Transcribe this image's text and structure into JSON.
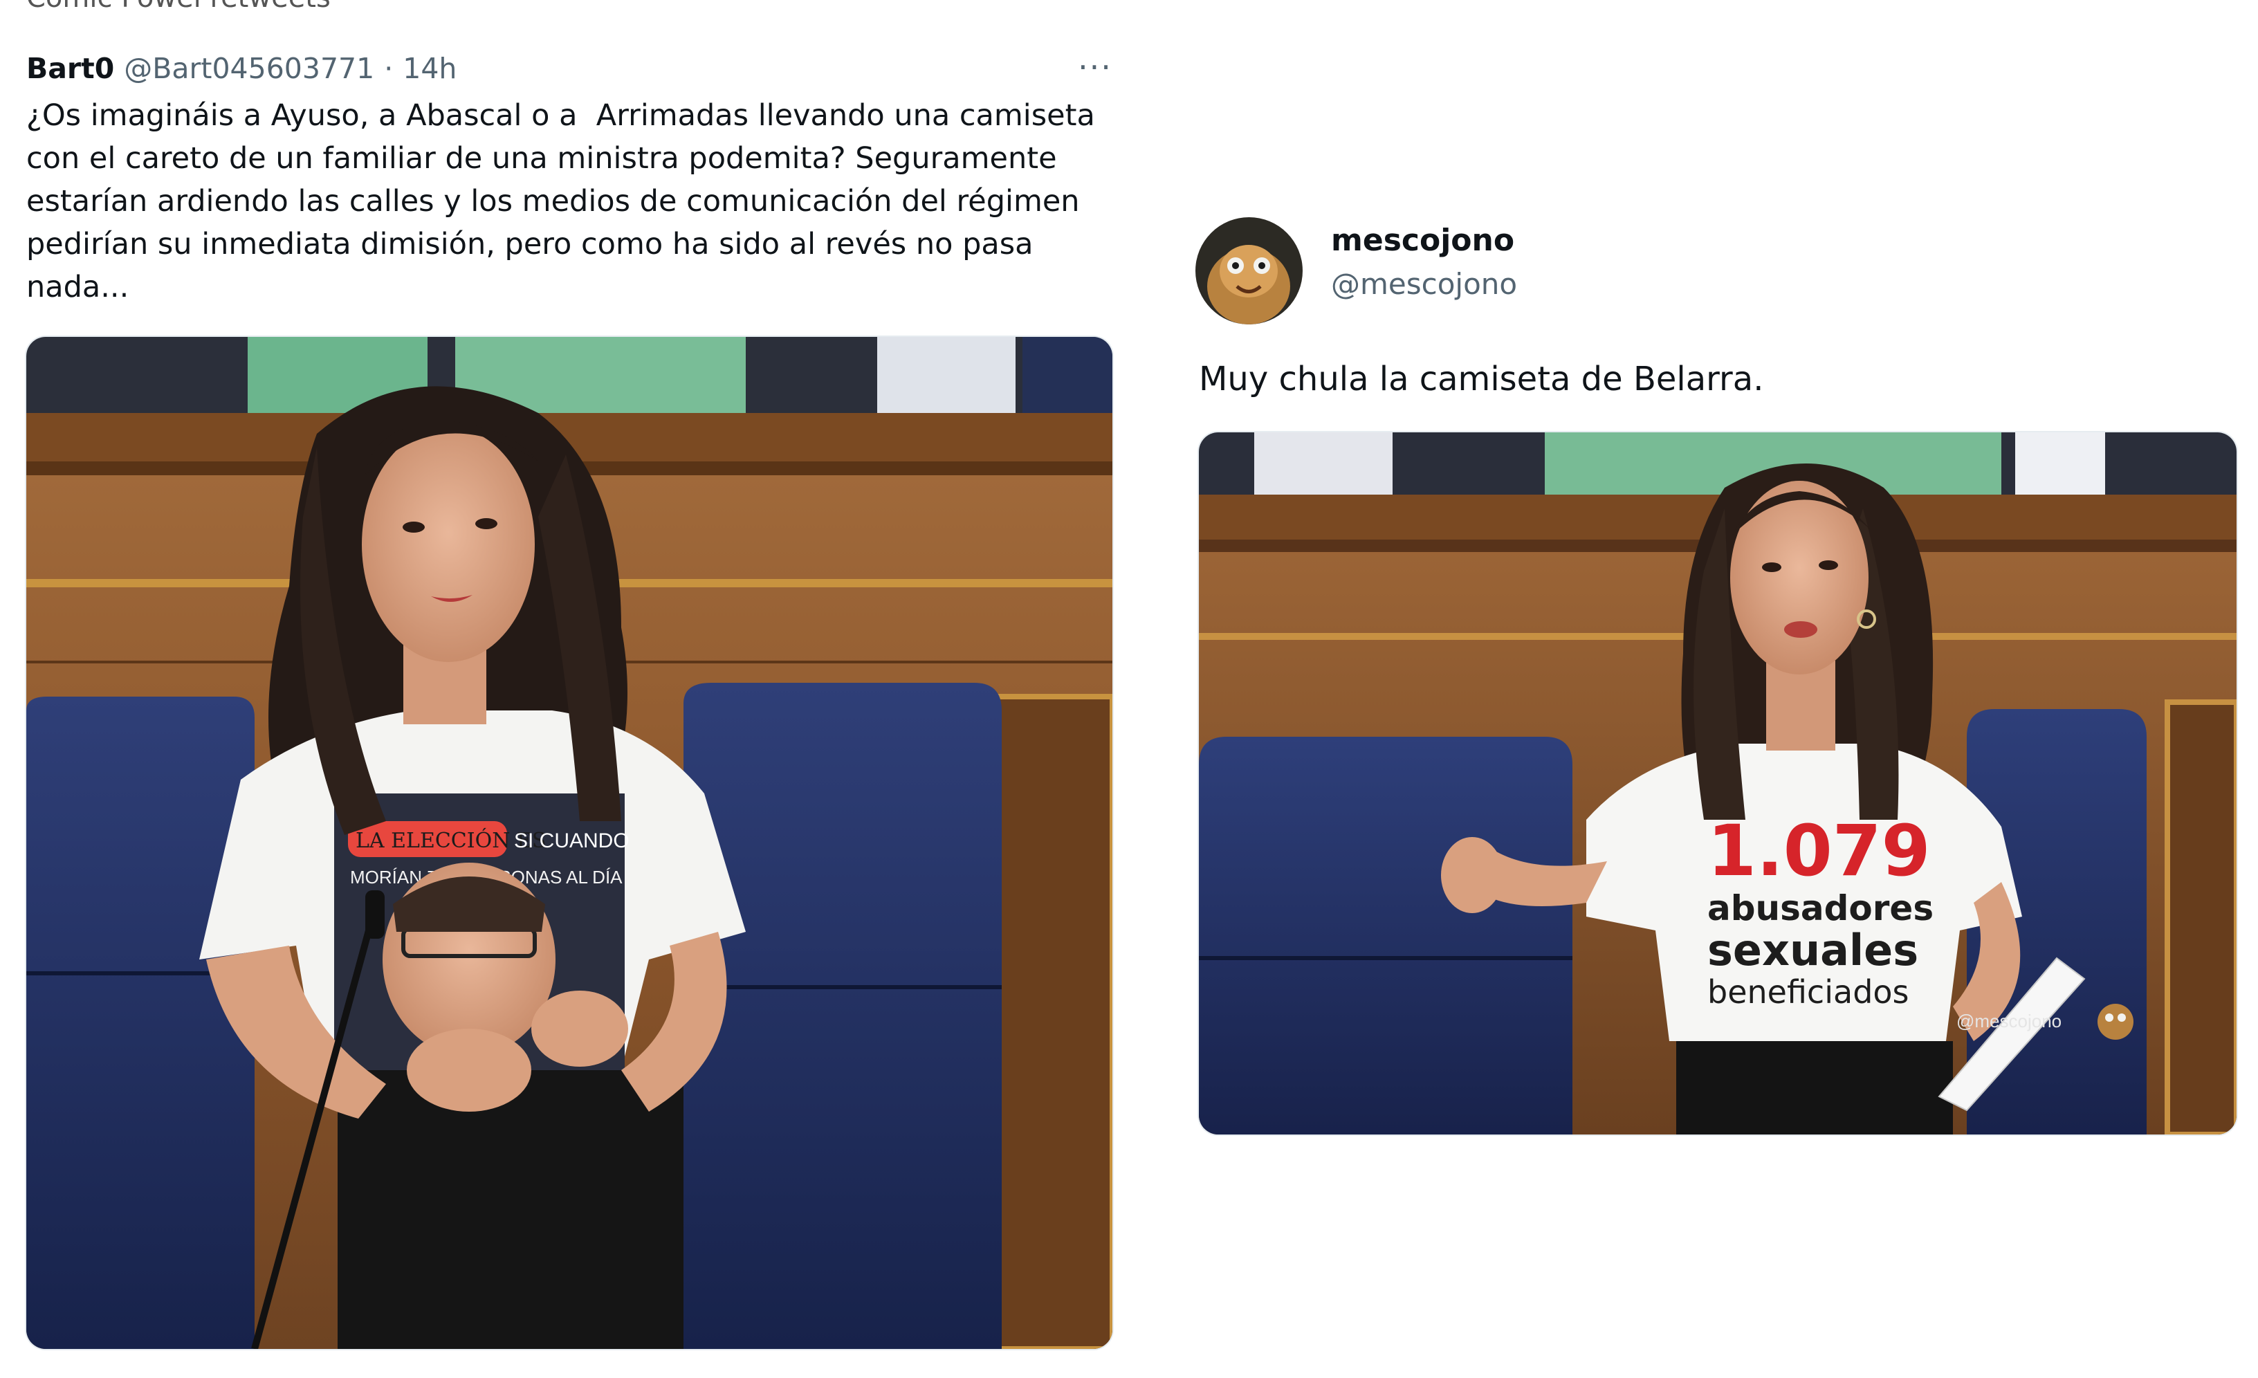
{
  "left_tweet": {
    "cutoff_text": "Cómic Powel retweets",
    "author": "Bart0",
    "handle": "@Bart045603771",
    "separator": "·",
    "time": "14h",
    "more": "···",
    "text": "¿Os imagináis a Ayuso, a Abascal o a  Arrimadas llevando una camiseta\ncon el careto de un familiar de una ministra podemita? Seguramente\nestarían ardiendo las calles y los medios de comunicación del régimen\npedirían su inmediata dimisión, pero como ha sido al revés no pasa\nnada...",
    "shirt_text_line1": "LA ELECCIÓN ES",
    "shirt_text_line2": "SI CUANDO",
    "shirt_text_line3": "MORÍAN 700 PERSONAS AL DÍA"
  },
  "right_tweet": {
    "author": "mescojono",
    "handle": "@mescojono",
    "text": "Muy chula la camiseta de Belarra.",
    "shirt_number": "1.079",
    "shirt_line2": "abusadores",
    "shirt_line3": "sexuales",
    "shirt_line4": "beneficiados",
    "watermark": "@mescojono"
  },
  "colors": {
    "text_primary": "#0f1419",
    "text_secondary": "#536471",
    "wood": "#8b5a2b",
    "seat_blue": "#1f2e5c",
    "shirt_red": "#d6242a"
  }
}
